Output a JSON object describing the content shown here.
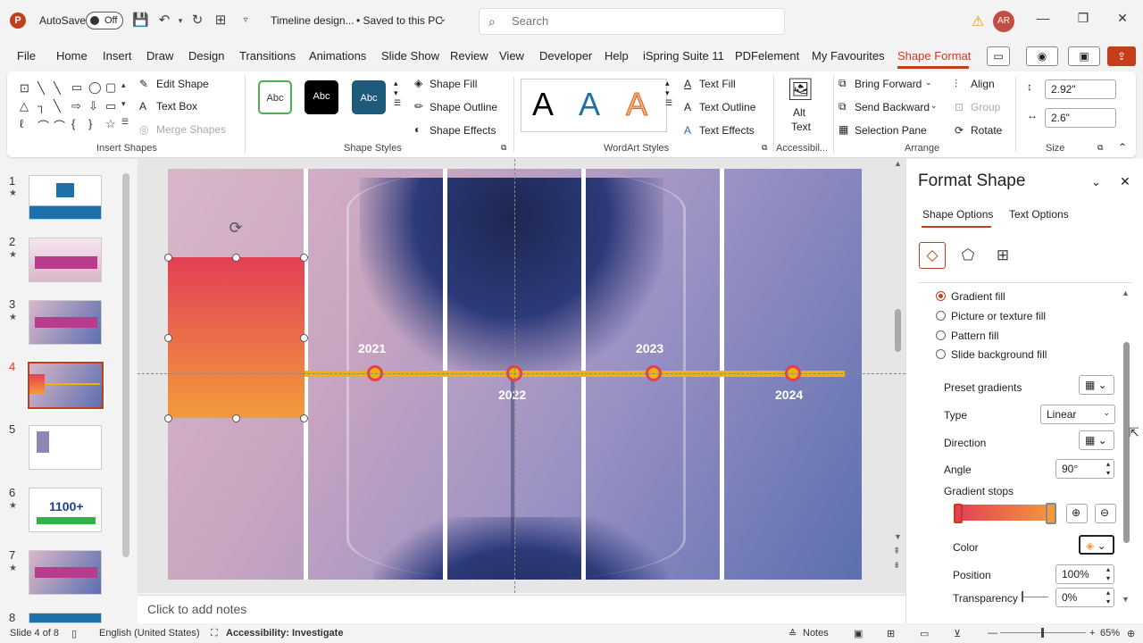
{
  "titlebar": {
    "app_icon": "P",
    "autosave_label": "AutoSave",
    "autosave_state": "Off",
    "doc_title": "Timeline design...",
    "save_status": "• Saved to this PC",
    "search_placeholder": "Search",
    "user_initials": "AR"
  },
  "menu": {
    "items": [
      "File",
      "Home",
      "Insert",
      "Draw",
      "Design",
      "Transitions",
      "Animations",
      "Slide Show",
      "Review",
      "View",
      "Developer",
      "Help",
      "iSpring Suite 11",
      "PDFelement",
      "My Favourites",
      "Shape Format"
    ],
    "active": "Shape Format"
  },
  "ribbon": {
    "insert_shapes": {
      "label": "Insert Shapes",
      "edit_shape": "Edit Shape",
      "text_box": "Text Box",
      "merge_shapes": "Merge Shapes"
    },
    "shape_styles": {
      "label": "Shape Styles",
      "preview": "Abc",
      "shape_fill": "Shape Fill",
      "shape_outline": "Shape Outline",
      "shape_effects": "Shape Effects"
    },
    "wordart": {
      "label": "WordArt Styles",
      "letter": "A",
      "text_fill": "Text Fill",
      "text_outline": "Text Outline",
      "text_effects": "Text Effects"
    },
    "accessibility": {
      "label": "Accessibil...",
      "alt_text_1": "Alt",
      "alt_text_2": "Text"
    },
    "arrange": {
      "label": "Arrange",
      "bring_forward": "Bring Forward",
      "send_backward": "Send Backward",
      "selection_pane": "Selection Pane",
      "align": "Align",
      "group": "Group",
      "rotate": "Rotate"
    },
    "size": {
      "label": "Size",
      "height": "2.92\"",
      "width": "2.6\""
    }
  },
  "slides": {
    "numbers": [
      "1",
      "2",
      "3",
      "4",
      "5",
      "6",
      "7",
      "8"
    ],
    "selected": "4",
    "thumb6_text": "1100+"
  },
  "slide": {
    "years": [
      "2021",
      "2022",
      "2023",
      "2024"
    ]
  },
  "notes": {
    "placeholder": "Click to add notes"
  },
  "format_pane": {
    "title": "Format Shape",
    "tabs": [
      "Shape Options",
      "Text Options"
    ],
    "fill_options": [
      "Gradient fill",
      "Picture or texture fill",
      "Pattern fill",
      "Slide background fill"
    ],
    "selected_fill": "Gradient fill",
    "preset_gradients": "Preset gradients",
    "type_label": "Type",
    "type_value": "Linear",
    "direction_label": "Direction",
    "angle_label": "Angle",
    "angle_value": "90°",
    "gradient_stops_label": "Gradient stops",
    "color_label": "Color",
    "position_label": "Position",
    "position_value": "100%",
    "transparency_label": "Transparency",
    "transparency_value": "0%",
    "gradient_colors": [
      "#e33f56",
      "#f39b3a"
    ]
  },
  "status": {
    "slide_info": "Slide 4 of 8",
    "language": "English (United States)",
    "accessibility": "Accessibility: Investigate",
    "notes": "Notes",
    "zoom": "65%"
  }
}
